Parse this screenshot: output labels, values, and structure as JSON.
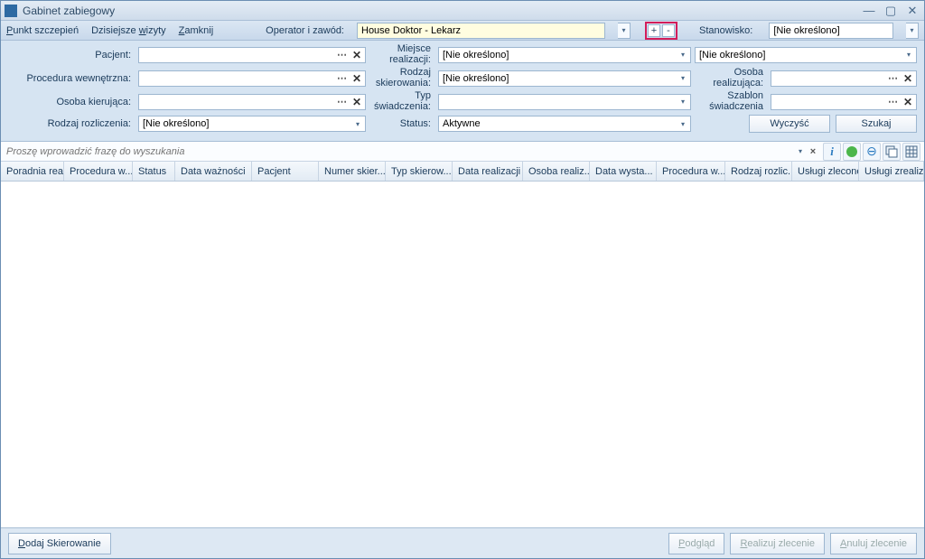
{
  "window": {
    "title": "Gabinet zabiegowy"
  },
  "menu": {
    "punkt": "Punkt szczepień",
    "wizyty": "Dzisiejsze wizyty",
    "zamknij": "Zamknij",
    "operator_label": "Operator i zawód:",
    "operator_value": "House Doktor - Lekarz",
    "stanowisko_label": "Stanowisko:",
    "stanowisko_value": "[Nie określono]"
  },
  "filters": {
    "pacjent_label": "Pacjent:",
    "procedura_label": "Procedura wewnętrzna:",
    "osoba_kier_label": "Osoba kierująca:",
    "rozliczenie_label": "Rodzaj rozliczenia:",
    "rozliczenie_value": "[Nie określono]",
    "miejsce_label": "Miejsce realizacji:",
    "miejsce_value": "[Nie określono]",
    "miejsce_value2": "[Nie określono]",
    "rodzaj_skier_label": "Rodzaj skierowania:",
    "rodzaj_skier_value": "[Nie określono]",
    "typ_label": "Typ świadczenia:",
    "status_label": "Status:",
    "status_value": "Aktywne",
    "osoba_real_label": "Osoba realizująca:",
    "szablon_label": "Szablon świadczenia",
    "wyczysc": "Wyczyść",
    "szukaj": "Szukaj"
  },
  "search": {
    "placeholder": "Proszę wprowadzić frazę do wyszukania"
  },
  "columns": {
    "c1": "Poradnia rea...",
    "c2": "Procedura w...",
    "c3": "Status",
    "c4": "Data ważności",
    "c5": "Pacjent",
    "c6": "Numer skier...",
    "c7": "Typ skierow...",
    "c8": "Data realizacji",
    "c9": "Osoba realiz...",
    "c10": "Data wysta...",
    "c11": "Procedura w...",
    "c12": "Rodzaj rozlic...",
    "c13": "Usługi zlecone",
    "c14": "Usługi zrealiz..."
  },
  "bottom": {
    "dodaj": "Dodaj Skierowanie",
    "podglad": "Podgląd",
    "realizuj": "Realizuj zlecenie",
    "anuluj": "Anuluj zlecenie"
  }
}
